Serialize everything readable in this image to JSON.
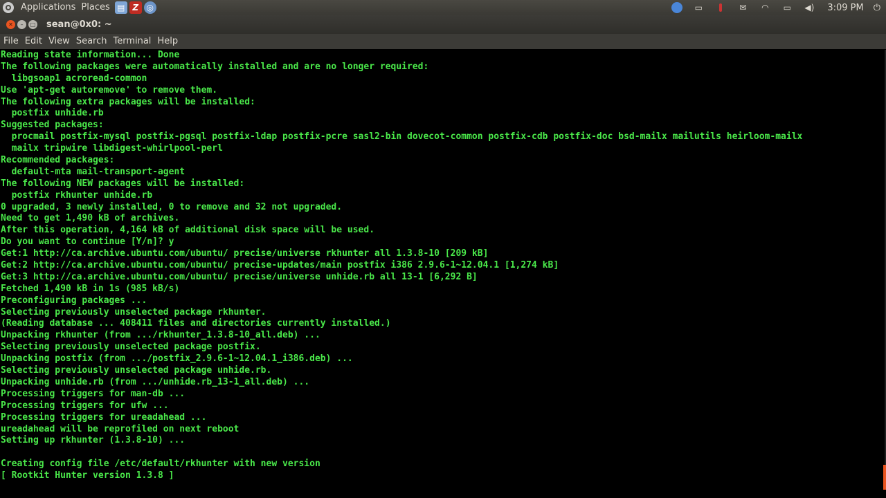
{
  "panel": {
    "applications_label": "Applications",
    "places_label": "Places",
    "clock": "3:09 PM"
  },
  "window": {
    "title": "sean@0x0: ~"
  },
  "menubar": {
    "file": "File",
    "edit": "Edit",
    "view": "View",
    "search": "Search",
    "terminal": "Terminal",
    "help": "Help"
  },
  "terminal": {
    "lines": [
      "Reading state information... Done",
      "The following packages were automatically installed and are no longer required:",
      "  libgsoap1 acroread-common",
      "Use 'apt-get autoremove' to remove them.",
      "The following extra packages will be installed:",
      "  postfix unhide.rb",
      "Suggested packages:",
      "  procmail postfix-mysql postfix-pgsql postfix-ldap postfix-pcre sasl2-bin dovecot-common postfix-cdb postfix-doc bsd-mailx mailutils heirloom-mailx",
      "  mailx tripwire libdigest-whirlpool-perl",
      "Recommended packages:",
      "  default-mta mail-transport-agent",
      "The following NEW packages will be installed:",
      "  postfix rkhunter unhide.rb",
      "0 upgraded, 3 newly installed, 0 to remove and 32 not upgraded.",
      "Need to get 1,490 kB of archives.",
      "After this operation, 4,164 kB of additional disk space will be used.",
      "Do you want to continue [Y/n]? y",
      "Get:1 http://ca.archive.ubuntu.com/ubuntu/ precise/universe rkhunter all 1.3.8-10 [209 kB]",
      "Get:2 http://ca.archive.ubuntu.com/ubuntu/ precise-updates/main postfix i386 2.9.6-1~12.04.1 [1,274 kB]",
      "Get:3 http://ca.archive.ubuntu.com/ubuntu/ precise/universe unhide.rb all 13-1 [6,292 B]",
      "Fetched 1,490 kB in 1s (985 kB/s)",
      "Preconfiguring packages ...",
      "Selecting previously unselected package rkhunter.",
      "(Reading database ... 408411 files and directories currently installed.)",
      "Unpacking rkhunter (from .../rkhunter_1.3.8-10_all.deb) ...",
      "Selecting previously unselected package postfix.",
      "Unpacking postfix (from .../postfix_2.9.6-1~12.04.1_i386.deb) ...",
      "Selecting previously unselected package unhide.rb.",
      "Unpacking unhide.rb (from .../unhide.rb_13-1_all.deb) ...",
      "Processing triggers for man-db ...",
      "Processing triggers for ufw ...",
      "Processing triggers for ureadahead ...",
      "ureadahead will be reprofiled on next reboot",
      "Setting up rkhunter (1.3.8-10) ...",
      "",
      "Creating config file /etc/default/rkhunter with new version",
      "[ Rootkit Hunter version 1.3.8 ]"
    ]
  },
  "colors": {
    "terminal_text": "#4ae84a",
    "terminal_bg": "#000000",
    "panel_bg": "#3c3b37",
    "close_button": "#e95420"
  },
  "icons": {
    "ubuntu_logo": "ubuntu-logo-icon",
    "files_launcher": "file-manager-icon",
    "filezilla_launcher": "filezilla-icon",
    "browser_launcher": "web-browser-icon",
    "chrome_tray": "chrome-icon",
    "notes_tray": "notes-icon",
    "red_tray": "red-indicator-icon",
    "mail_tray": "mail-icon",
    "wifi_tray": "wifi-icon",
    "battery_tray": "battery-icon",
    "volume_tray": "volume-icon",
    "power": "power-icon"
  }
}
